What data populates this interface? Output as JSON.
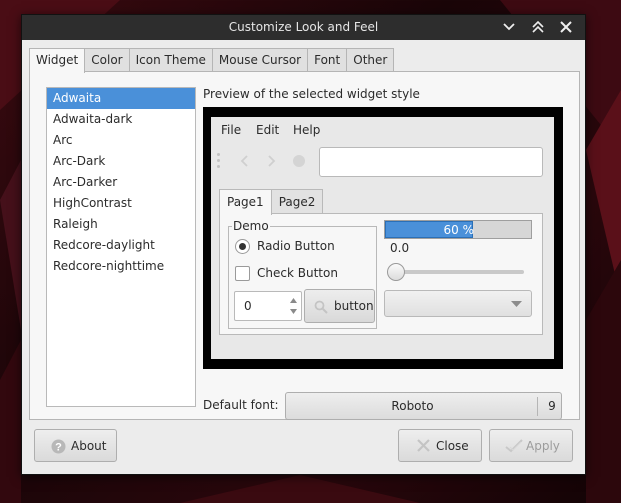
{
  "window": {
    "title": "Customize Look and Feel"
  },
  "tabs": [
    "Widget",
    "Color",
    "Icon Theme",
    "Mouse Cursor",
    "Font",
    "Other"
  ],
  "active_tab": "Widget",
  "widget_styles": [
    "Adwaita",
    "Adwaita-dark",
    "Arc",
    "Arc-Dark",
    "Arc-Darker",
    "HighContrast",
    "Raleigh",
    "Redcore-daylight",
    "Redcore-nighttime"
  ],
  "selected_style": "Adwaita",
  "preview": {
    "label": "Preview of the selected widget style",
    "menu": [
      "File",
      "Edit",
      "Help"
    ],
    "url_value": "",
    "tabs": [
      "Page1",
      "Page2"
    ],
    "demo_group": "Demo",
    "radio_label": "Radio Button",
    "radio_checked": true,
    "check_label": "Check Button",
    "check_checked": false,
    "spin_value": "0",
    "button_label": "button",
    "progress_text": "60 %",
    "progress_fraction": 0.6,
    "scale_value": "0.0",
    "combo_value": ""
  },
  "default_font": {
    "label": "Default font:",
    "name": "Roboto",
    "size": "9"
  },
  "buttons": {
    "about": "About",
    "close": "Close",
    "apply": "Apply"
  },
  "colors": {
    "accent": "#4a90d9",
    "titlebar": "#2d2d2d",
    "window_bg": "#ececec"
  }
}
